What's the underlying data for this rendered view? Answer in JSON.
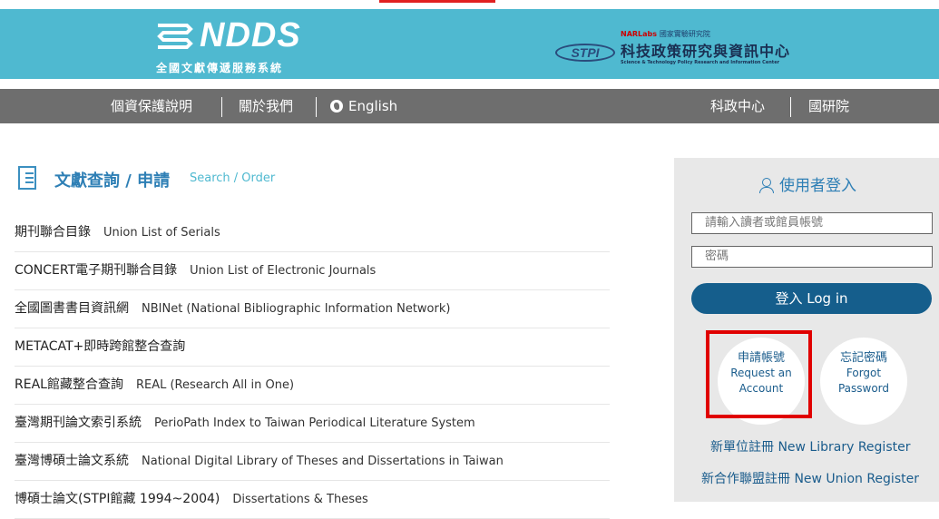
{
  "header": {
    "logo_name": "NDDS",
    "logo_subtitle": "全國文獻傳遞服務系統",
    "stpi_badge": "STPI",
    "narl_label": "NARLabs",
    "narl_rest": "國家實驗研究院",
    "stpi_name_cn": "科技政策研究與資訊中心",
    "stpi_name_en": "Science & Technology Policy Research and Information Center"
  },
  "nav": {
    "privacy": "個資保護說明",
    "about": "關於我們",
    "english": "English",
    "stpi": "科政中心",
    "narl": "國研院"
  },
  "section": {
    "title_zh": "文獻查詢 / 申請",
    "title_en": "Search / Order"
  },
  "resources": [
    {
      "zh": "期刊聯合目錄",
      "en": "Union List of Serials"
    },
    {
      "zh": "CONCERT電子期刊聯合目錄",
      "en": "Union List of Electronic Journals"
    },
    {
      "zh": "全國圖書書目資訊網",
      "en": "NBINet (National Bibliographic Information Network)"
    },
    {
      "zh": "METACAT+即時跨館整合查詢",
      "en": ""
    },
    {
      "zh": "REAL館藏整合查詢",
      "en": "REAL (Research All in One)"
    },
    {
      "zh": "臺灣期刊論文索引系統",
      "en": "PerioPath Index to Taiwan Periodical Literature System"
    },
    {
      "zh": "臺灣博碩士論文系統",
      "en": "National Digital Library of Theses and Dissertations in Taiwan"
    },
    {
      "zh": "博碩士論文(STPI館藏 1994~2004)",
      "en": "Dissertations & Theses"
    }
  ],
  "login": {
    "title": "使用者登入",
    "username_placeholder": "請輸入讀者或館員帳號",
    "password_placeholder": "密碼",
    "login_button": "登入 Log in",
    "request_zh": "申請帳號",
    "request_en1": "Request an",
    "request_en2": "Account",
    "forgot_zh": "忘記密碼",
    "forgot_en1": "Forgot",
    "forgot_en2": "Password",
    "new_library": "新單位註冊  New Library Register",
    "new_union": "新合作聯盟註冊  New Union Register"
  },
  "colors": {
    "header_bg": "#4fb9d0",
    "nav_bg": "#6e6e6e",
    "login_button": "#155e8c",
    "highlight": "#e00000"
  }
}
